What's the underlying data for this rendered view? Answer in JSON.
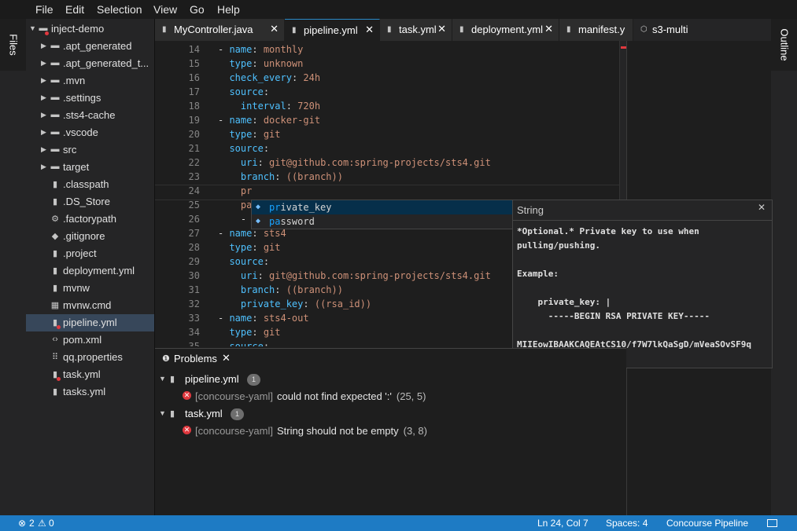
{
  "menu": [
    "File",
    "Edit",
    "Selection",
    "View",
    "Go",
    "Help"
  ],
  "left_panel_label": "Files",
  "right_panel_label": "Outline",
  "explorer": {
    "items": [
      {
        "label": "inject-demo",
        "icon": "folder",
        "arrow": "▼",
        "depth": 0
      },
      {
        "label": ".apt_generated",
        "icon": "folder",
        "arrow": "▶",
        "depth": 1
      },
      {
        "label": ".apt_generated_t...",
        "icon": "folder",
        "arrow": "▶",
        "depth": 1
      },
      {
        "label": ".mvn",
        "icon": "folder",
        "arrow": "▶",
        "depth": 1
      },
      {
        "label": ".settings",
        "icon": "folder",
        "arrow": "▶",
        "depth": 1
      },
      {
        "label": ".sts4-cache",
        "icon": "folder",
        "arrow": "▶",
        "depth": 1
      },
      {
        "label": ".vscode",
        "icon": "folder",
        "arrow": "▶",
        "depth": 1
      },
      {
        "label": "src",
        "icon": "folder",
        "arrow": "▶",
        "depth": 1
      },
      {
        "label": "target",
        "icon": "folder",
        "arrow": "▶",
        "depth": 1
      },
      {
        "label": ".classpath",
        "icon": "file",
        "arrow": "",
        "depth": 1
      },
      {
        "label": ".DS_Store",
        "icon": "file",
        "arrow": "",
        "depth": 1
      },
      {
        "label": ".factorypath",
        "icon": "gear",
        "arrow": "",
        "depth": 1
      },
      {
        "label": ".gitignore",
        "icon": "git",
        "arrow": "",
        "depth": 1
      },
      {
        "label": ".project",
        "icon": "file",
        "arrow": "",
        "depth": 1
      },
      {
        "label": "deployment.yml",
        "icon": "file",
        "arrow": "",
        "depth": 1
      },
      {
        "label": "mvnw",
        "icon": "file",
        "arrow": "",
        "depth": 1
      },
      {
        "label": "mvnw.cmd",
        "icon": "windows",
        "arrow": "",
        "depth": 1
      },
      {
        "label": "pipeline.yml",
        "icon": "file",
        "arrow": "",
        "depth": 1,
        "selected": true
      },
      {
        "label": "pom.xml",
        "icon": "code",
        "arrow": "",
        "depth": 1
      },
      {
        "label": "qq.properties",
        "icon": "grid",
        "arrow": "",
        "depth": 1
      },
      {
        "label": "task.yml",
        "icon": "file",
        "arrow": "",
        "depth": 1
      },
      {
        "label": "tasks.yml",
        "icon": "file",
        "arrow": "",
        "depth": 1
      }
    ]
  },
  "tabs": [
    {
      "label": "MyController.java",
      "close": "✕"
    },
    {
      "label": "pipeline.yml",
      "close": "✕",
      "active": true
    },
    {
      "label": "task.yml",
      "close": "✕"
    },
    {
      "label": "deployment.yml",
      "close": "✕"
    },
    {
      "label": "manifest.y",
      "close": ""
    },
    {
      "label": "s3-multi",
      "close": ""
    }
  ],
  "editor": {
    "lines": [
      {
        "n": "14",
        "t": [
          [
            "d",
            "- "
          ],
          [
            "k",
            "name"
          ],
          [
            "d",
            ": "
          ],
          [
            "v",
            "monthly"
          ]
        ]
      },
      {
        "n": "15",
        "t": [
          [
            "d",
            "  "
          ],
          [
            "k",
            "type"
          ],
          [
            "d",
            ": "
          ],
          [
            "v",
            "unknown"
          ]
        ]
      },
      {
        "n": "16",
        "t": [
          [
            "d",
            "  "
          ],
          [
            "k",
            "check_every"
          ],
          [
            "d",
            ": "
          ],
          [
            "v",
            "24h"
          ]
        ]
      },
      {
        "n": "17",
        "t": [
          [
            "d",
            "  "
          ],
          [
            "k",
            "source"
          ],
          [
            "d",
            ":"
          ]
        ]
      },
      {
        "n": "18",
        "t": [
          [
            "d",
            "    "
          ],
          [
            "k",
            "interval"
          ],
          [
            "d",
            ": "
          ],
          [
            "v",
            "720h"
          ]
        ]
      },
      {
        "n": "19",
        "t": [
          [
            "d",
            "- "
          ],
          [
            "k",
            "name"
          ],
          [
            "d",
            ": "
          ],
          [
            "v",
            "docker-git"
          ]
        ]
      },
      {
        "n": "20",
        "t": [
          [
            "d",
            "  "
          ],
          [
            "k",
            "type"
          ],
          [
            "d",
            ": "
          ],
          [
            "v",
            "git"
          ]
        ]
      },
      {
        "n": "21",
        "t": [
          [
            "d",
            "  "
          ],
          [
            "k",
            "source"
          ],
          [
            "d",
            ":"
          ]
        ]
      },
      {
        "n": "22",
        "t": [
          [
            "d",
            "    "
          ],
          [
            "k",
            "uri"
          ],
          [
            "d",
            ": "
          ],
          [
            "v",
            "git@github.com:spring-projects/sts4.git"
          ]
        ]
      },
      {
        "n": "23",
        "t": [
          [
            "d",
            "    "
          ],
          [
            "k",
            "branch"
          ],
          [
            "d",
            ": "
          ],
          [
            "v",
            "((branch))"
          ]
        ]
      },
      {
        "n": "24",
        "t": [
          [
            "d",
            "    "
          ],
          [
            "v",
            "pr"
          ]
        ]
      },
      {
        "n": "25",
        "t": [
          [
            "d",
            "    "
          ],
          [
            "v",
            "pa"
          ]
        ]
      },
      {
        "n": "26",
        "t": [
          [
            "d",
            "    "
          ],
          [
            "d",
            "-"
          ]
        ]
      },
      {
        "n": "27",
        "t": [
          [
            "d",
            "- "
          ],
          [
            "k",
            "name"
          ],
          [
            "d",
            ": "
          ],
          [
            "v",
            "sts4"
          ]
        ]
      },
      {
        "n": "28",
        "t": [
          [
            "d",
            "  "
          ],
          [
            "k",
            "type"
          ],
          [
            "d",
            ": "
          ],
          [
            "v",
            "git"
          ]
        ]
      },
      {
        "n": "29",
        "t": [
          [
            "d",
            "  "
          ],
          [
            "k",
            "source"
          ],
          [
            "d",
            ":"
          ]
        ]
      },
      {
        "n": "30",
        "t": [
          [
            "d",
            "    "
          ],
          [
            "k",
            "uri"
          ],
          [
            "d",
            ": "
          ],
          [
            "v",
            "git@github.com:spring-projects/sts4.git"
          ]
        ]
      },
      {
        "n": "31",
        "t": [
          [
            "d",
            "    "
          ],
          [
            "k",
            "branch"
          ],
          [
            "d",
            ": "
          ],
          [
            "v",
            "((branch))"
          ]
        ]
      },
      {
        "n": "32",
        "t": [
          [
            "d",
            "    "
          ],
          [
            "k",
            "private_key"
          ],
          [
            "d",
            ": "
          ],
          [
            "v",
            "((rsa_id))"
          ]
        ]
      },
      {
        "n": "33",
        "t": [
          [
            "d",
            "- "
          ],
          [
            "k",
            "name"
          ],
          [
            "d",
            ": "
          ],
          [
            "v",
            "sts4-out"
          ]
        ]
      },
      {
        "n": "34",
        "t": [
          [
            "d",
            "  "
          ],
          [
            "k",
            "type"
          ],
          [
            "d",
            ": "
          ],
          [
            "v",
            "git"
          ]
        ]
      },
      {
        "n": "35",
        "t": [
          [
            "d",
            "  "
          ],
          [
            "k",
            "source"
          ],
          [
            "d",
            ":"
          ]
        ]
      }
    ]
  },
  "suggest": {
    "items": [
      {
        "match": "pr",
        "rest": "ivate_key",
        "selected": true
      },
      {
        "match": "pa",
        "rest": "ssword",
        "selected": false
      }
    ]
  },
  "docs": {
    "type": "String",
    "close": "✕",
    "body": [
      "*Optional.* Private key to use when",
      "pulling/pushing.",
      "",
      "Example:",
      "",
      "    private_key: |",
      "      -----BEGIN RSA PRIVATE KEY-----",
      "",
      "MIIEowIBAAKCAQEAtCS10/f7W7lkQaSgD/mVeaSOvSF9q"
    ]
  },
  "problems": {
    "tab_label": "Problems",
    "close": "✕",
    "files": [
      {
        "name": "pipeline.yml",
        "count": "1",
        "messages": [
          {
            "source": "[concourse-yaml]",
            "text": "could not find expected ':'",
            "pos": "(25, 5)"
          }
        ]
      },
      {
        "name": "task.yml",
        "count": "1",
        "messages": [
          {
            "source": "[concourse-yaml]",
            "text": "String should not be empty",
            "pos": "(3, 8)"
          }
        ]
      }
    ]
  },
  "status": {
    "errors": "2",
    "warnings": "0",
    "position": "Ln 24, Col 7",
    "spaces": "Spaces: 4",
    "language": "Concourse Pipeline"
  },
  "colors": {
    "accent": "#1e7bc4",
    "error": "#e0383e",
    "key": "#4fc1ff",
    "value": "#ce9178"
  }
}
